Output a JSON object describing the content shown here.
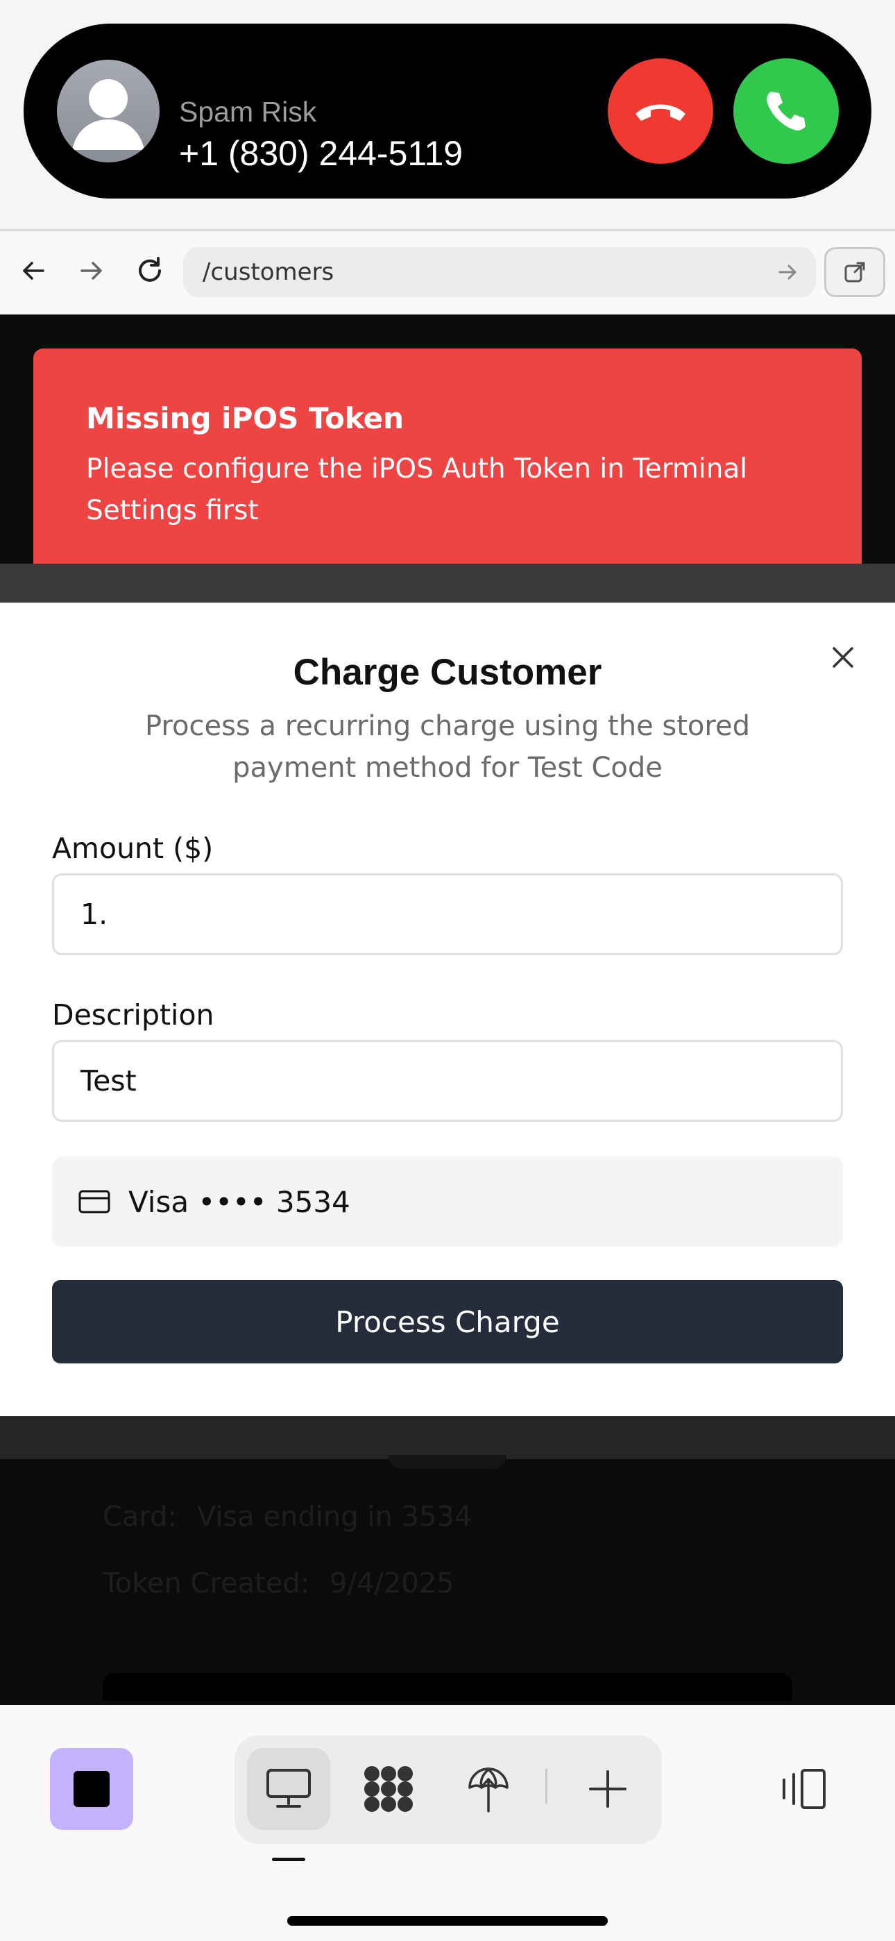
{
  "call": {
    "caller_label": "Spam Risk",
    "phone_number": "+1 (830) 244-5119",
    "decline_icon": "phone-decline-icon",
    "accept_icon": "phone-accept-icon"
  },
  "browser": {
    "url": "/customers",
    "back_icon": "arrow-left-icon",
    "forward_icon": "arrow-right-icon",
    "reload_icon": "reload-icon",
    "open_external_icon": "external-link-icon"
  },
  "toast": {
    "title": "Missing iPOS Token",
    "description": "Please configure the iPOS Auth Token in Terminal Settings first",
    "color": "#ef4444"
  },
  "modal": {
    "title": "Charge Customer",
    "subtitle": "Process a recurring charge using the stored payment method for Test Code",
    "amount_label": "Amount ($)",
    "amount_value": "1.",
    "description_label": "Description",
    "description_value": "Test",
    "card_brand": "Visa",
    "card_masked": "Visa •••• 3534",
    "process_button": "Process Charge",
    "button_color": "#252d3d"
  },
  "background_details": {
    "card_label": "Card:",
    "card_value": "Visa ending in 3534",
    "token_label": "Token Created:",
    "token_value": "9/4/2025"
  },
  "toolbar": {
    "stop_color": "#c5b3ff",
    "tools": [
      "desktop-icon",
      "apps-grid-icon",
      "network-icon",
      "add-icon"
    ],
    "panel_icon": "side-panel-icon"
  }
}
